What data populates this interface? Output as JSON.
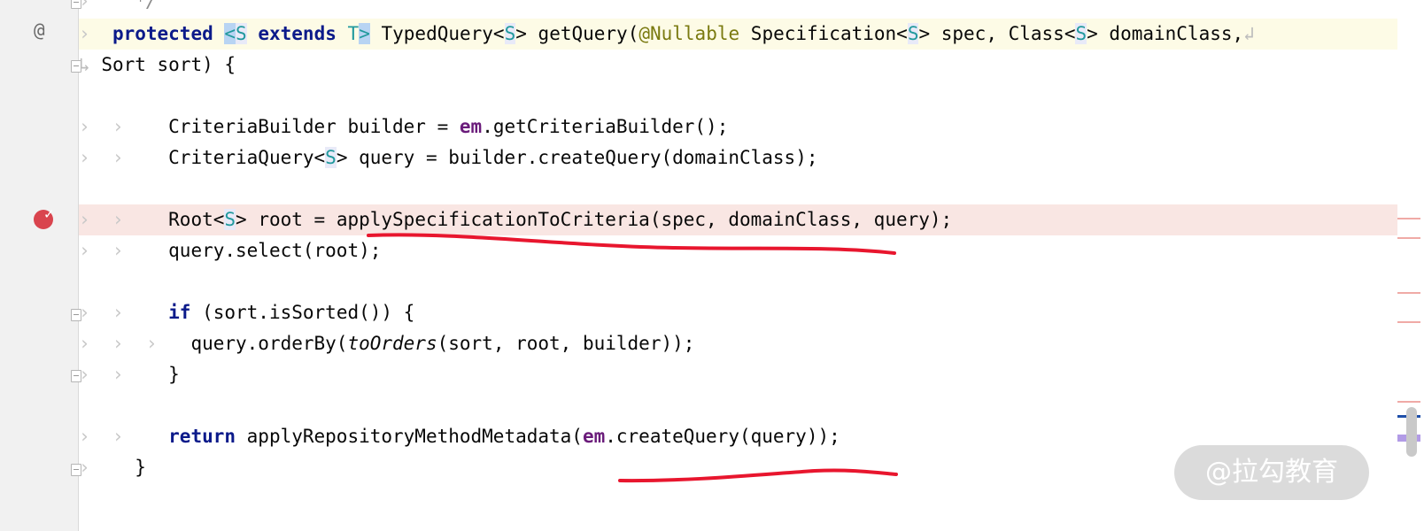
{
  "gutter": {
    "override_marker": "@"
  },
  "code": {
    "comment_end": "*/",
    "l1": {
      "kw_protected": "protected",
      "lt": "<",
      "S1": "S",
      "kw_extends": "extends",
      "T": "T",
      "gt": ">",
      "ret_type": "TypedQuery<",
      "S2": "S",
      "ret_close": ">",
      "method": "getQuery(",
      "annotation": "@Nullable",
      "p1type": "Specification<",
      "S3": "S",
      "p1rest": "> spec, Class<",
      "S4": "S",
      "p2rest": "> domainClass,"
    },
    "l2": "Sort sort) {",
    "l3a": "CriteriaBuilder builder = ",
    "l3em": "em",
    "l3b": ".getCriteriaBuilder();",
    "l4a": "CriteriaQuery<",
    "l4S": "S",
    "l4b": "> query = builder.createQuery(domainClass);",
    "l5a": "Root<",
    "l5S": "S",
    "l5b": "> root = applySpecificationToCriteria(spec, domainClass, query);",
    "l6": "query.select(root);",
    "l7kw": "if",
    "l7b": " (sort.isSorted()) {",
    "l8a": "query.orderBy(",
    "l8i": "toOrders",
    "l8b": "(sort, root, builder));",
    "l9": "}",
    "l10kw": "return",
    "l10a": " applyRepositoryMethodMetadata(",
    "l10em": "em",
    "l10b": ".createQuery(query));",
    "l11": "}"
  },
  "watermark": "@拉勾教育",
  "colors": {
    "keyword": "#0b1a8a",
    "field": "#6a1b7a",
    "annotation": "#7a7a10",
    "type_param": "#20999d",
    "underline": "#e8162e",
    "breakpoint": "#d9444e"
  }
}
